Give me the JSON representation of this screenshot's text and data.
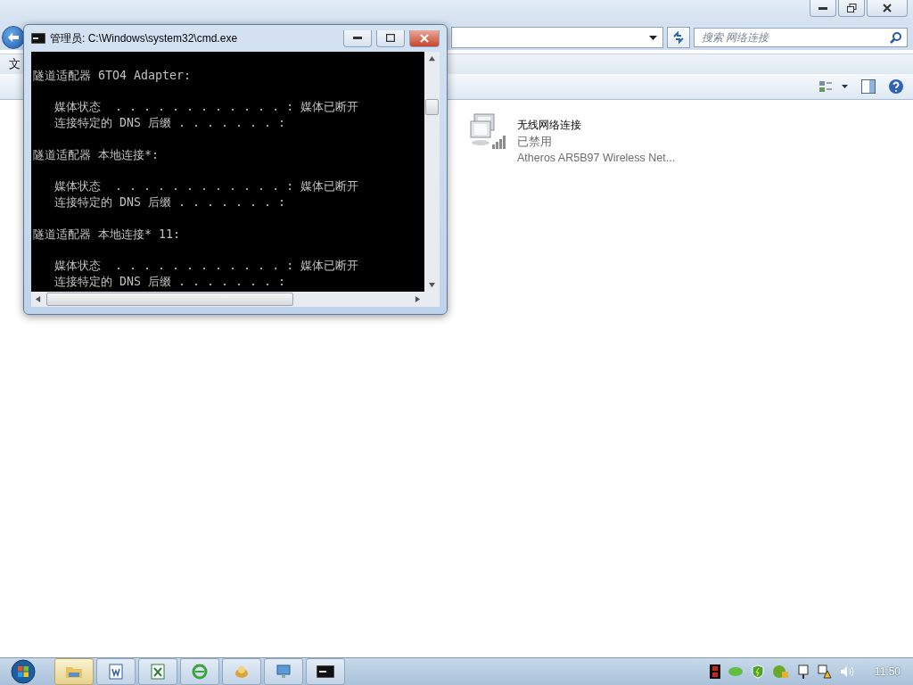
{
  "explorer": {
    "search": {
      "placeholder": "搜索 网络连接"
    },
    "menu_bar": [
      "文"
    ],
    "connections": [
      {
        "name": "无线网络连接",
        "status": "已禁用",
        "device": "Atheros AR5B97 Wireless Net..."
      }
    ]
  },
  "console": {
    "title": "管理员: C:\\Windows\\system32\\cmd.exe",
    "blocks": [
      {
        "heading": "隧道适配器 6TO4 Adapter:",
        "rows": [
          "媒体状态  . . . . . . . . . . . . : 媒体已断开",
          "连接特定的 DNS 后缀 . . . . . . . :"
        ]
      },
      {
        "heading": "隧道适配器 本地连接*:",
        "rows": [
          "媒体状态  . . . . . . . . . . . . : 媒体已断开",
          "连接特定的 DNS 后缀 . . . . . . . :"
        ]
      },
      {
        "heading": "隧道适配器 本地连接* 11:",
        "rows": [
          "媒体状态  . . . . . . . . . . . . : 媒体已断开",
          "连接特定的 DNS 后缀 . . . . . . . :"
        ]
      }
    ]
  },
  "taskbar": {
    "buttons": [
      {
        "kind": "folder",
        "selected": true
      },
      {
        "kind": "word",
        "selected": false
      },
      {
        "kind": "excel",
        "selected": false
      },
      {
        "kind": "browser",
        "selected": false
      },
      {
        "kind": "app",
        "selected": false
      },
      {
        "kind": "monitor",
        "selected": false
      },
      {
        "kind": "console",
        "selected": false
      }
    ],
    "clock": "11:50"
  }
}
